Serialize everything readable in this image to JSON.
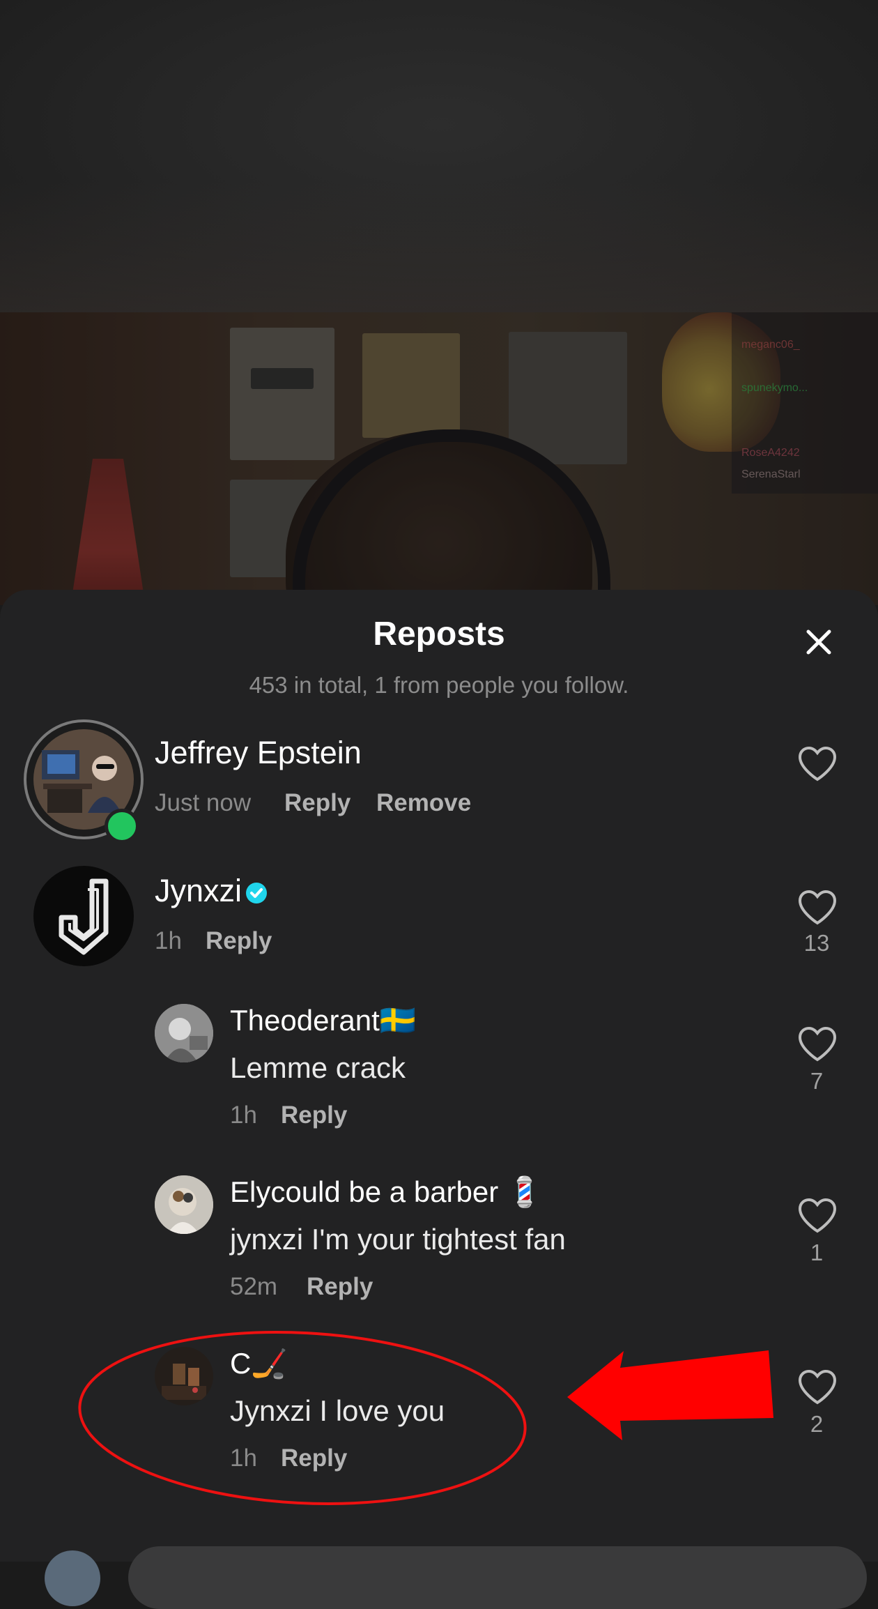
{
  "stream_overlay": {
    "chat_names": [
      "",
      "meganc06_",
      "",
      "spunekymo...",
      "",
      "",
      "RoseA4242",
      "SerenaStarl"
    ]
  },
  "sheet": {
    "title": "Reposts",
    "subtitle": "453 in total, 1 from people you follow."
  },
  "reposts": [
    {
      "name": "Jeffrey Epstein",
      "time": "Just now",
      "reply_label": "Reply",
      "remove_label": "Remove",
      "online": true,
      "likes": ""
    },
    {
      "name": "Jynxzi",
      "verified": true,
      "time": "1h",
      "reply_label": "Reply",
      "likes": "13"
    }
  ],
  "replies": [
    {
      "name": "Theoderant🇸🇪",
      "text": "Lemme crack",
      "time": "1h",
      "reply_label": "Reply",
      "likes": "7"
    },
    {
      "name": "Elycould be a barber 💈",
      "text": "jynxzi I'm your tightest fan",
      "time": "52m",
      "reply_label": "Reply",
      "likes": "1"
    },
    {
      "name": "C🏒",
      "text": "Jynxzi I love you",
      "time": "1h",
      "reply_label": "Reply",
      "likes": "2"
    }
  ],
  "colors": {
    "sheet_bg": "#222223",
    "online_dot": "#22c55e",
    "verified": "#20d5ec",
    "annotation_red": "#ff0000"
  }
}
